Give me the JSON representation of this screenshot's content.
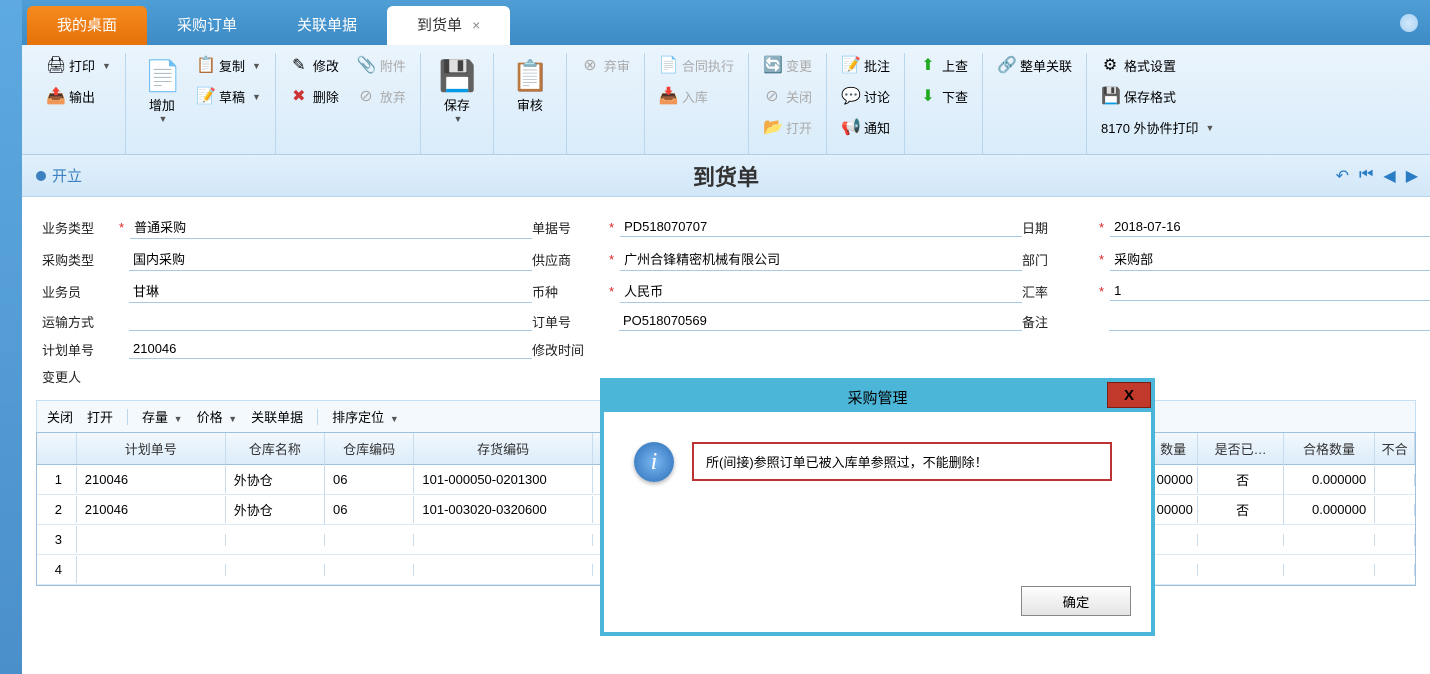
{
  "tabs": [
    "我的桌面",
    "采购订单",
    "关联单据",
    "到货单"
  ],
  "toolbar": {
    "print": "打印",
    "export": "输出",
    "add": "增加",
    "copy": "复制",
    "draft": "草稿",
    "edit": "修改",
    "delete": "删除",
    "attach": "附件",
    "abandon": "放弃",
    "save": "保存",
    "audit": "审核",
    "unaudit": "弃审",
    "contract": "合同执行",
    "instore": "入库",
    "change": "变更",
    "close": "关闭",
    "open": "打开",
    "approve": "批注",
    "discuss": "讨论",
    "notify": "通知",
    "up": "上查",
    "down": "下查",
    "wholelink": "整单关联",
    "fmtset": "格式设置",
    "savefmt": "保存格式",
    "tmpl": "8170 外协件打印"
  },
  "title": {
    "status": "开立",
    "big": "到货单"
  },
  "form": {
    "biztype_l": "业务类型",
    "biztype": "普通采购",
    "purchasetype_l": "采购类型",
    "purchasetype": "国内采购",
    "clerk_l": "业务员",
    "clerk": "甘琳",
    "transport_l": "运输方式",
    "transport": "",
    "planno_l": "计划单号",
    "planno": "210046",
    "changer_l": "变更人",
    "changer": "",
    "docno_l": "单据号",
    "docno": "PD518070707",
    "supplier_l": "供应商",
    "supplier": "广州合锋精密机械有限公司",
    "currency_l": "币种",
    "currency": "人民币",
    "orderno_l": "订单号",
    "orderno": "PO518070569",
    "modtime_l": "修改时间",
    "modtime": "",
    "date_l": "日期",
    "date": "2018-07-16",
    "dept_l": "部门",
    "dept": "采购部",
    "rate_l": "汇率",
    "rate": "1",
    "remark_l": "备注",
    "remark": ""
  },
  "tbbar": {
    "close": "关闭",
    "open": "打开",
    "stock": "存量",
    "price": "价格",
    "link": "关联单据",
    "sort": "排序定位"
  },
  "cols": {
    "plan": "计划单号",
    "wh": "仓库名称",
    "whcode": "仓库编码",
    "invcode": "存货编码",
    "qty": "数量",
    "checked": "是否已…",
    "okqty": "合格数量",
    "bad": "不合"
  },
  "rows": [
    {
      "n": "1",
      "plan": "210046",
      "wh": "外协仓",
      "whcode": "06",
      "inv": "101-000050-0201300",
      "qty": "00000",
      "checked": "否",
      "ok": "0.000000"
    },
    {
      "n": "2",
      "plan": "210046",
      "wh": "外协仓",
      "whcode": "06",
      "inv": "101-003020-0320600",
      "qty": "00000",
      "checked": "否",
      "ok": "0.000000"
    },
    {
      "n": "3"
    },
    {
      "n": "4"
    }
  ],
  "modal": {
    "title": "采购管理",
    "msg": "所(间接)参照订单已被入库单参照过，不能删除！",
    "ok": "确定",
    "close": "X"
  }
}
